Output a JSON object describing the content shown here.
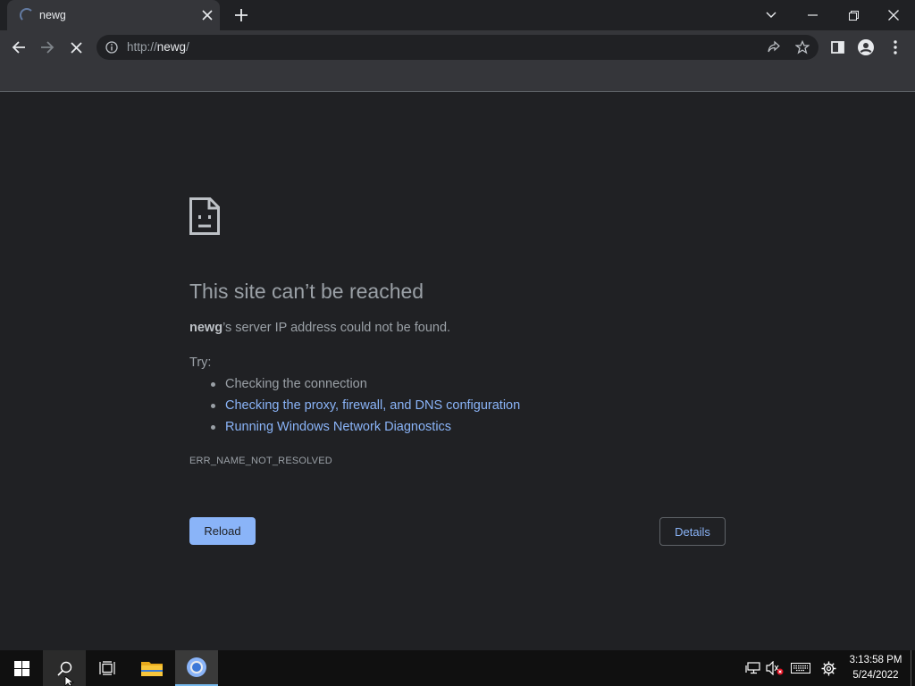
{
  "browser": {
    "tab": {
      "title": "newg"
    },
    "address": {
      "scheme": "http://",
      "host": "newg",
      "path": "/"
    }
  },
  "error_page": {
    "title": "This site can’t be reached",
    "message_host": "newg",
    "message_rest": "’s server IP address could not be found.",
    "try_label": "Try:",
    "suggestions": [
      {
        "text": "Checking the connection",
        "link": false
      },
      {
        "text": "Checking the proxy, firewall, and DNS configuration",
        "link": true
      },
      {
        "text": "Running Windows Network Diagnostics",
        "link": true
      }
    ],
    "error_code": "ERR_NAME_NOT_RESOLVED",
    "reload_label": "Reload",
    "details_label": "Details"
  },
  "taskbar": {
    "clock_time": "3:13:58 PM",
    "clock_date": "5/24/2022"
  },
  "colors": {
    "background": "#202124",
    "toolbar": "#35363a",
    "link": "#8ab4f8",
    "taskbar": "#101010"
  },
  "icons": [
    "loading-spinner-icon",
    "close-icon",
    "plus-icon",
    "chevron-down-icon",
    "minimize-icon",
    "restore-icon",
    "back-arrow-icon",
    "forward-arrow-icon",
    "stop-icon",
    "info-icon",
    "share-icon",
    "star-icon",
    "side-panel-icon",
    "profile-icon",
    "more-vert-icon",
    "sad-page-icon",
    "windows-start-icon",
    "search-icon",
    "task-view-icon",
    "file-explorer-icon",
    "chrome-icon",
    "network-icon",
    "volume-muted-icon",
    "keyboard-icon",
    "settings-icon"
  ]
}
